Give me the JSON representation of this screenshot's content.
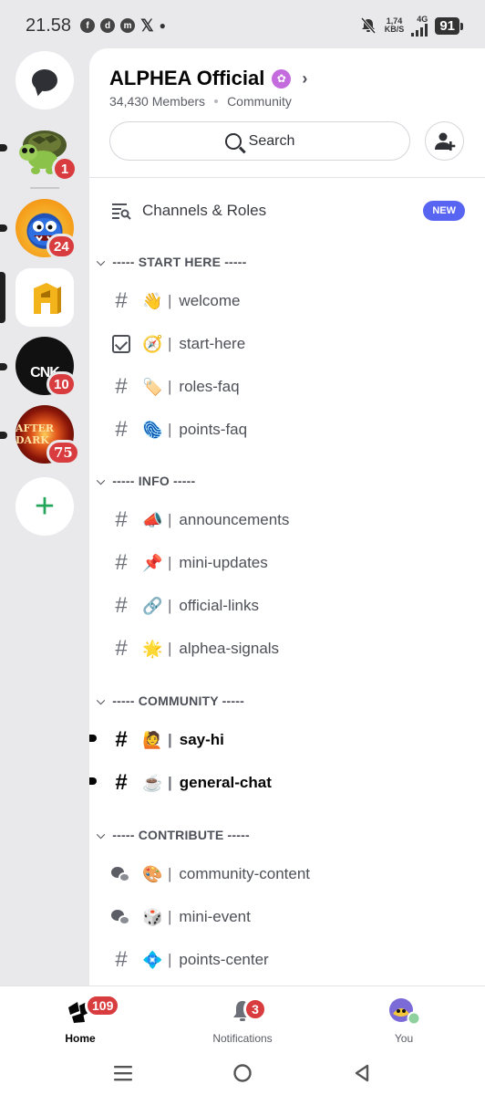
{
  "status_bar": {
    "time": "21.58",
    "net_speed_value": "1,74",
    "net_speed_unit": "KB/S",
    "network": "4G",
    "battery": "91"
  },
  "server_rail": {
    "servers": [
      {
        "name": "turtle-server",
        "badge": "1"
      },
      {
        "name": "blue-monster-server",
        "badge": "24"
      },
      {
        "name": "alphea-server",
        "badge": ""
      },
      {
        "name": "cnk-server",
        "badge": "10",
        "label": "CNK"
      },
      {
        "name": "after-dark-server",
        "badge": "75",
        "label": "AFTER DARK"
      }
    ]
  },
  "header": {
    "title": "ALPHEA Official",
    "members": "34,430 Members",
    "type": "Community",
    "search_label": "Search"
  },
  "channels_roles": {
    "label": "Channels & Roles",
    "badge": "NEW"
  },
  "categories": [
    {
      "label": "----- START HERE -----",
      "channels": [
        {
          "icon": "hash",
          "emoji": "👋",
          "name": "welcome",
          "unread": false
        },
        {
          "icon": "rules",
          "emoji": "🧭",
          "name": "start-here",
          "unread": false
        },
        {
          "icon": "hash",
          "emoji": "🏷️",
          "name": "roles-faq",
          "unread": false
        },
        {
          "icon": "hash",
          "emoji": "🫆",
          "name": "points-faq",
          "unread": false
        }
      ]
    },
    {
      "label": "----- INFO -----",
      "channels": [
        {
          "icon": "hash",
          "emoji": "📣",
          "name": "announcements",
          "unread": false
        },
        {
          "icon": "hash",
          "emoji": "📌",
          "name": "mini-updates",
          "unread": false
        },
        {
          "icon": "hash",
          "emoji": "🔗",
          "name": "official-links",
          "unread": false
        },
        {
          "icon": "hash",
          "emoji": "🌟",
          "name": "alphea-signals",
          "unread": false
        }
      ]
    },
    {
      "label": "----- COMMUNITY -----",
      "channels": [
        {
          "icon": "hash",
          "emoji": "🙋",
          "name": "say-hi",
          "unread": true
        },
        {
          "icon": "hash",
          "emoji": "☕",
          "name": "general-chat",
          "unread": true
        }
      ]
    },
    {
      "label": "----- CONTRIBUTE -----",
      "channels": [
        {
          "icon": "forum",
          "emoji": "🎨",
          "name": "community-content",
          "unread": false
        },
        {
          "icon": "forum",
          "emoji": "🎲",
          "name": "mini-event",
          "unread": false
        },
        {
          "icon": "hash",
          "emoji": "💠",
          "name": "points-center",
          "unread": false
        }
      ]
    }
  ],
  "bottom_nav": {
    "home": {
      "label": "Home",
      "badge": "109"
    },
    "notifications": {
      "label": "Notifications",
      "badge": "3"
    },
    "you": {
      "label": "You"
    }
  },
  "colors": {
    "accent": "#5865f2",
    "badge_red": "#d83c3e",
    "online_green": "#23a55a"
  }
}
